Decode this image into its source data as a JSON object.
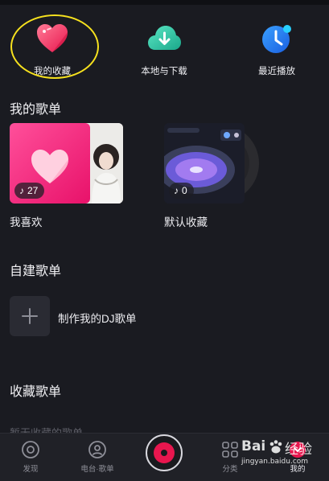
{
  "quick_entries": [
    {
      "label": "我的收藏",
      "icon": "heart-icon"
    },
    {
      "label": "本地与下载",
      "icon": "download-cloud-icon"
    },
    {
      "label": "最近播放",
      "icon": "clock-icon"
    }
  ],
  "my_playlists": {
    "title": "我的歌单",
    "items": [
      {
        "label": "我喜欢",
        "count": "27",
        "icon": "music-note-icon"
      },
      {
        "label": "默认收藏",
        "count": "0",
        "icon": "music-note-icon"
      }
    ]
  },
  "created_playlists": {
    "title": "自建歌单",
    "create_label": "制作我的DJ歌单",
    "create_icon": "plus-icon"
  },
  "collected_playlists": {
    "title": "收藏歌单",
    "empty_text": "暂无收藏的歌单"
  },
  "bottom_nav": [
    {
      "label": "发现",
      "icon": "discover-icon"
    },
    {
      "label": "电台·歌单",
      "icon": "radio-icon"
    },
    {
      "label": "分类",
      "icon": "grid-icon"
    },
    {
      "label": "我的",
      "icon": "profile-icon"
    }
  ],
  "watermark": {
    "brand": "Bai",
    "brand_cn": "经验",
    "url": "jingyan.baidu.com"
  },
  "colors": {
    "accent": "#e8164e",
    "highlight_ring": "#f6e11e",
    "background": "#1a1b21"
  }
}
